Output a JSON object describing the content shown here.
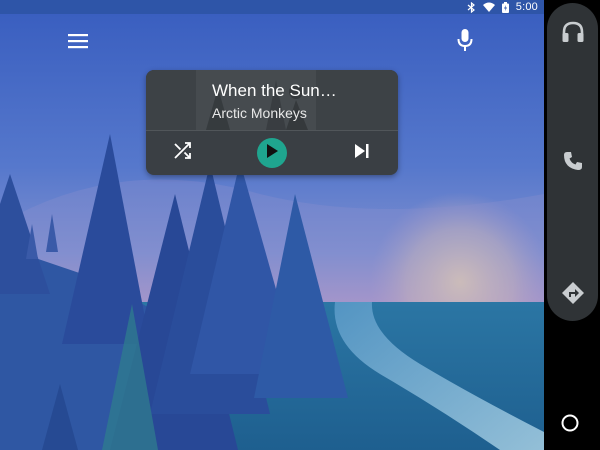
{
  "status_bar": {
    "time": "5:00",
    "icons": [
      "bluetooth-icon",
      "wifi-icon",
      "battery-icon"
    ]
  },
  "top_bar": {
    "menu_icon": "menu-icon",
    "mic_icon": "mic-icon"
  },
  "media": {
    "title": "When the Sun…",
    "artist": "Arctic Monkeys",
    "controls": [
      "shuffle-icon",
      "play-icon",
      "skip-next-icon"
    ],
    "accent": "#1fa58f"
  },
  "rail": {
    "items": [
      "headphones-icon",
      "phone-icon",
      "directions-icon"
    ],
    "home": "home-circle-icon"
  },
  "colors": {
    "status_bar": "#2e55a8",
    "card": "#3a3f44",
    "rail_panel": "#2f3336"
  }
}
